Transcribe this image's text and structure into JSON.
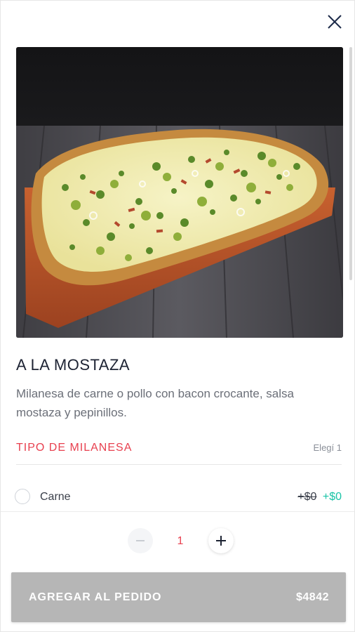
{
  "product": {
    "title": "A LA MOSTAZA",
    "description": "Milanesa de carne o pollo con bacon crocante, salsa mostaza y pepinillos.",
    "image_alt": "Milanesa a la mostaza"
  },
  "option_group": {
    "title": "TIPO DE MILANESA",
    "rule": "Elegí 1",
    "options": [
      {
        "label": "Carne",
        "price_old": "+$0",
        "price_new": "+$0",
        "selected": false
      }
    ]
  },
  "quantity": {
    "value": "1"
  },
  "add_to_order": {
    "label": "AGREGAR AL PEDIDO",
    "total": "$4842"
  },
  "colors": {
    "accent_red": "#e8404f",
    "accent_teal": "#19c3a6",
    "button_disabled": "#b6b6b6",
    "title_text": "#1d2333"
  }
}
